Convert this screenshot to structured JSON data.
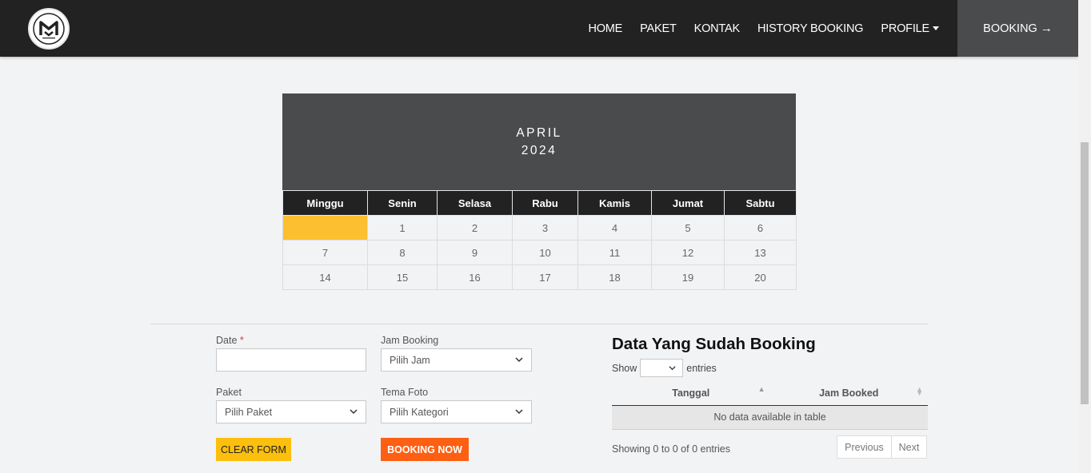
{
  "nav": {
    "links": [
      "HOME",
      "PAKET",
      "KONTAK",
      "HISTORY BOOKING",
      "PROFILE"
    ],
    "cta": "BOOKING",
    "cta_arrow": "→"
  },
  "calendar": {
    "month": "APRIL",
    "year": "2024",
    "weekdays": [
      "Minggu",
      "Senin",
      "Selasa",
      "Rabu",
      "Kamis",
      "Jumat",
      "Sabtu"
    ],
    "weeks": [
      [
        "",
        "1",
        "2",
        "3",
        "4",
        "5",
        "6"
      ],
      [
        "7",
        "8",
        "9",
        "10",
        "11",
        "12",
        "13"
      ],
      [
        "14",
        "15",
        "16",
        "17",
        "18",
        "19",
        "20"
      ]
    ]
  },
  "form": {
    "date_label": "Date",
    "date_required": "*",
    "date_value": "",
    "jam_label": "Jam Booking",
    "jam_value": "Pilih Jam",
    "paket_label": "Paket",
    "paket_value": "Pilih Paket",
    "tema_label": "Tema Foto",
    "tema_value": "Pilih Kategori",
    "clear_label": "CLEAR FORM",
    "booking_label": "BOOKING NOW"
  },
  "datatable": {
    "title": "Data Yang Sudah Booking",
    "show_label": "Show",
    "entries_label": "entries",
    "length_value": "",
    "columns": [
      "Tanggal",
      "Jam Booked"
    ],
    "empty_message": "No data available in table",
    "info": "Showing 0 to 0 of 0 entries",
    "prev_label": "Previous",
    "next_label": "Next"
  },
  "colors": {
    "navbar": "#222222",
    "cta_bg": "#4a4b4d",
    "highlight": "#fcbf30",
    "clear_btn": "#fcbf0e",
    "booking_btn": "#fd5f13"
  }
}
